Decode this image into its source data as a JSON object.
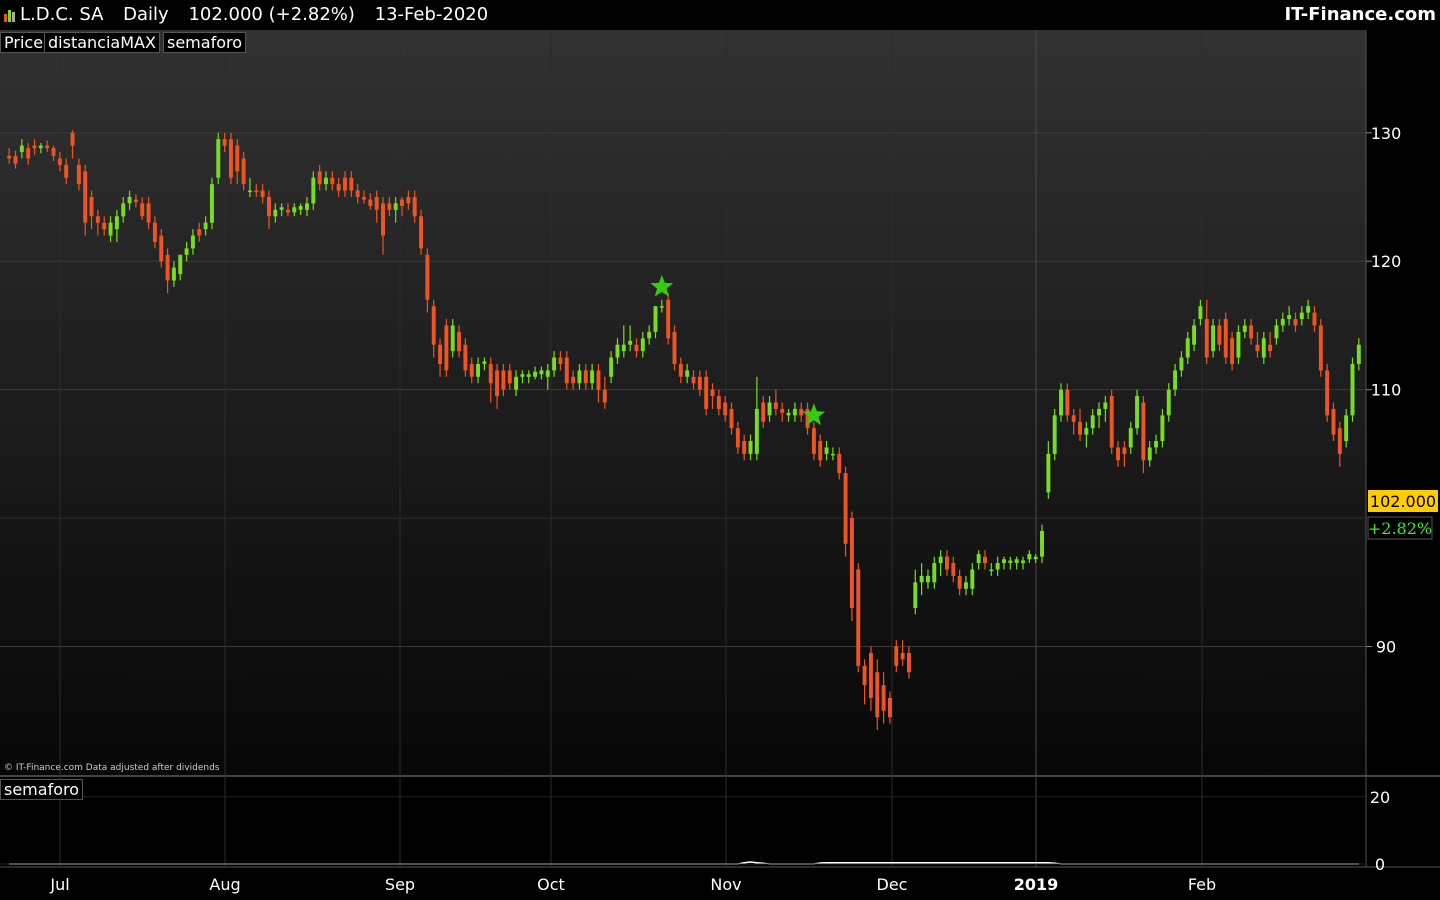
{
  "header": {
    "symbol": "L.D.C. SA",
    "period": "Daily",
    "price_change": "102.000 (+2.82%)",
    "date": "13-Feb-2020",
    "brand": "IT-Finance.com"
  },
  "legend_tags": [
    "Price",
    "distanciaMAX",
    "semaforo"
  ],
  "indicator_tag": "semaforo",
  "footnote": "© IT-Finance.com  Data adjusted after dividends",
  "last_price_label": "102.000",
  "last_change_label": "+2.82%",
  "colors": {
    "up": "#77dd22",
    "down": "#ee5522",
    "star": "#33cc11",
    "price_box": "#ffcc00"
  },
  "chart_data": {
    "type": "candlestick",
    "y_axis": {
      "range": [
        80,
        138
      ],
      "ticks": [
        130,
        120,
        110,
        90
      ]
    },
    "x_axis_labels": [
      "Jul",
      "Aug",
      "Sep",
      "Oct",
      "Nov",
      "Dec",
      "2019",
      "Feb"
    ],
    "candles": [
      [
        128.2,
        128.8,
        127.6,
        128.0
      ],
      [
        128.2,
        128.6,
        127.2,
        127.6
      ],
      [
        128.5,
        129.5,
        128.0,
        129.0
      ],
      [
        128.8,
        129.2,
        127.5,
        128.0
      ],
      [
        129.0,
        129.5,
        128.3,
        128.8
      ],
      [
        128.8,
        129.2,
        128.4,
        129.0
      ],
      [
        129.0,
        129.4,
        128.5,
        128.8
      ],
      [
        128.8,
        129.0,
        127.8,
        128.2
      ],
      [
        128.0,
        128.5,
        127.0,
        127.5
      ],
      [
        127.5,
        128.0,
        126.0,
        126.5
      ],
      [
        130.0,
        130.2,
        128.0,
        129.0
      ],
      [
        127.5,
        128.0,
        125.5,
        126.0
      ],
      [
        127.0,
        127.5,
        122.0,
        123.0
      ],
      [
        125.0,
        125.5,
        122.5,
        123.5
      ],
      [
        123.5,
        124.0,
        122.0,
        123.0
      ],
      [
        123.0,
        123.5,
        122.0,
        122.5
      ],
      [
        122.0,
        123.5,
        121.5,
        123.0
      ],
      [
        122.5,
        124.0,
        121.5,
        123.5
      ],
      [
        123.5,
        125.0,
        123.0,
        124.5
      ],
      [
        124.5,
        125.5,
        124.0,
        125.0
      ],
      [
        124.8,
        125.2,
        124.2,
        124.6
      ],
      [
        124.5,
        125.0,
        123.2,
        123.5
      ],
      [
        124.5,
        125.0,
        122.5,
        123.0
      ],
      [
        123.0,
        123.5,
        121.0,
        121.5
      ],
      [
        122.0,
        122.5,
        119.5,
        120.0
      ],
      [
        120.5,
        121.0,
        117.5,
        118.5
      ],
      [
        118.5,
        120.0,
        118.0,
        119.5
      ],
      [
        119.0,
        120.5,
        118.5,
        120.5
      ],
      [
        120.5,
        121.5,
        120.0,
        121.0
      ],
      [
        121.0,
        122.5,
        120.5,
        122.0
      ],
      [
        122.5,
        123.0,
        121.5,
        122.0
      ],
      [
        122.5,
        123.5,
        122.0,
        123.0
      ],
      [
        123.0,
        126.5,
        122.5,
        126.0
      ],
      [
        126.5,
        130.0,
        126.0,
        129.5
      ],
      [
        129.5,
        130.0,
        128.5,
        129.0
      ],
      [
        129.5,
        130.0,
        126.0,
        126.5
      ],
      [
        129.0,
        129.5,
        126.0,
        127.0
      ],
      [
        128.0,
        128.5,
        125.5,
        126.0
      ],
      [
        125.5,
        126.5,
        125.0,
        125.5
      ],
      [
        125.5,
        126.0,
        125.0,
        125.4
      ],
      [
        125.5,
        126.0,
        124.5,
        125.0
      ],
      [
        125.0,
        125.5,
        122.5,
        123.5
      ],
      [
        123.5,
        124.5,
        123.0,
        124.0
      ],
      [
        124.0,
        124.5,
        123.5,
        124.2
      ],
      [
        124.0,
        124.5,
        123.5,
        123.8
      ],
      [
        123.8,
        124.5,
        123.5,
        124.2
      ],
      [
        124.0,
        124.5,
        123.6,
        124.3
      ],
      [
        124.0,
        125.0,
        123.5,
        124.5
      ],
      [
        124.5,
        127.0,
        124.0,
        126.5
      ],
      [
        127.0,
        127.5,
        125.5,
        126.0
      ],
      [
        126.0,
        127.0,
        125.5,
        126.5
      ],
      [
        126.5,
        127.0,
        125.5,
        126.0
      ],
      [
        126.0,
        126.5,
        125.0,
        125.5
      ],
      [
        126.5,
        127.0,
        125.0,
        125.5
      ],
      [
        126.5,
        127.0,
        125.0,
        125.5
      ],
      [
        125.5,
        126.0,
        124.5,
        125.0
      ],
      [
        125.0,
        125.5,
        124.5,
        124.8
      ],
      [
        124.8,
        125.3,
        124.0,
        124.3
      ],
      [
        125.0,
        125.5,
        123.0,
        124.0
      ],
      [
        124.5,
        125.0,
        120.5,
        122.0
      ],
      [
        124.5,
        125.0,
        123.5,
        124.0
      ],
      [
        124.0,
        125.0,
        123.0,
        124.5
      ],
      [
        124.8,
        125.0,
        123.5,
        124.3
      ],
      [
        125.0,
        125.5,
        124.0,
        124.5
      ],
      [
        125.0,
        125.5,
        123.0,
        123.5
      ],
      [
        123.5,
        124.0,
        120.5,
        121.0
      ],
      [
        120.5,
        121.0,
        116.0,
        117.0
      ],
      [
        116.5,
        117.0,
        112.5,
        113.5
      ],
      [
        113.5,
        114.0,
        111.0,
        112.0
      ],
      [
        115.0,
        115.5,
        111.0,
        111.5
      ],
      [
        113.0,
        115.5,
        112.5,
        115.0
      ],
      [
        114.5,
        115.0,
        112.5,
        113.0
      ],
      [
        113.5,
        114.0,
        111.0,
        111.5
      ],
      [
        112.0,
        112.5,
        110.5,
        111.0
      ],
      [
        111.0,
        112.5,
        110.5,
        112.0
      ],
      [
        112.0,
        112.5,
        111.5,
        112.2
      ],
      [
        112.0,
        112.5,
        109.0,
        110.5
      ],
      [
        111.5,
        112.0,
        108.5,
        109.5
      ],
      [
        111.5,
        112.0,
        109.5,
        110.0
      ],
      [
        111.5,
        112.0,
        110.0,
        110.5
      ],
      [
        110.0,
        111.5,
        109.5,
        111.0
      ],
      [
        111.0,
        111.5,
        110.5,
        111.2
      ],
      [
        111.0,
        111.5,
        110.5,
        111.2
      ],
      [
        111.0,
        111.8,
        110.8,
        111.4
      ],
      [
        111.2,
        111.8,
        110.8,
        111.5
      ],
      [
        111.0,
        112.0,
        110.0,
        111.5
      ],
      [
        111.5,
        113.0,
        111.0,
        112.5
      ],
      [
        112.5,
        113.0,
        111.5,
        112.0
      ],
      [
        112.5,
        113.0,
        110.0,
        110.5
      ],
      [
        111.0,
        111.5,
        110.0,
        110.5
      ],
      [
        110.5,
        112.0,
        110.0,
        111.5
      ],
      [
        111.5,
        112.0,
        110.0,
        110.5
      ],
      [
        110.5,
        112.0,
        110.0,
        111.5
      ],
      [
        111.5,
        112.0,
        109.0,
        110.0
      ],
      [
        110.0,
        111.0,
        108.5,
        109.0
      ],
      [
        111.0,
        113.0,
        110.5,
        112.5
      ],
      [
        112.5,
        114.0,
        112.0,
        113.5
      ],
      [
        113.0,
        115.0,
        112.5,
        113.5
      ],
      [
        113.5,
        115.0,
        113.0,
        113.8
      ],
      [
        113.5,
        114.0,
        112.5,
        113.0
      ],
      [
        113.0,
        114.5,
        112.5,
        114.0
      ],
      [
        114.0,
        115.0,
        113.5,
        114.5
      ],
      [
        114.5,
        116.5,
        114.0,
        116.5
      ],
      [
        116.5,
        117.0,
        116.0,
        116.5
      ],
      [
        117.0,
        117.5,
        113.5,
        114.0
      ],
      [
        114.5,
        115.0,
        111.5,
        112.0
      ],
      [
        112.0,
        112.5,
        110.5,
        111.0
      ],
      [
        111.0,
        112.0,
        110.5,
        111.5
      ],
      [
        111.0,
        111.5,
        110.0,
        110.5
      ],
      [
        111.0,
        111.5,
        109.5,
        110.0
      ],
      [
        111.0,
        111.5,
        108.0,
        108.5
      ],
      [
        110.0,
        110.5,
        108.5,
        109.5
      ],
      [
        109.5,
        110.0,
        108.0,
        108.5
      ],
      [
        109.0,
        109.5,
        107.5,
        108.0
      ],
      [
        108.5,
        109.0,
        106.5,
        107.0
      ],
      [
        107.0,
        107.5,
        105.0,
        105.5
      ],
      [
        106.0,
        106.5,
        104.5,
        105.0
      ],
      [
        105.0,
        106.5,
        104.5,
        106.0
      ],
      [
        105.0,
        111.0,
        104.5,
        108.5
      ],
      [
        109.0,
        109.5,
        107.0,
        107.5
      ],
      [
        108.0,
        109.5,
        107.5,
        109.0
      ],
      [
        109.0,
        110.0,
        108.0,
        108.5
      ],
      [
        108.5,
        109.0,
        107.5,
        108.2
      ],
      [
        108.0,
        108.5,
        107.5,
        108.2
      ],
      [
        108.0,
        109.0,
        107.5,
        108.5
      ],
      [
        108.5,
        109.0,
        107.5,
        108.0
      ],
      [
        108.5,
        109.0,
        106.5,
        107.0
      ],
      [
        107.0,
        107.5,
        104.5,
        105.0
      ],
      [
        106.0,
        106.5,
        104.0,
        104.5
      ],
      [
        105.0,
        106.0,
        104.5,
        105.5
      ],
      [
        105.0,
        105.5,
        104.5,
        105.0
      ],
      [
        105.0,
        105.5,
        103.0,
        103.5
      ],
      [
        103.5,
        104.0,
        97.0,
        98.0
      ],
      [
        100.0,
        100.5,
        92.0,
        93.0
      ],
      [
        96.0,
        96.5,
        88.0,
        88.5
      ],
      [
        88.5,
        89.0,
        85.5,
        87.0
      ],
      [
        89.5,
        90.0,
        85.0,
        86.0
      ],
      [
        88.0,
        89.0,
        83.5,
        84.5
      ],
      [
        87.0,
        88.0,
        84.0,
        85.0
      ],
      [
        86.0,
        86.5,
        84.0,
        84.5
      ],
      [
        90.0,
        90.5,
        88.0,
        88.5
      ],
      [
        89.5,
        90.5,
        88.5,
        89.0
      ],
      [
        89.5,
        90.0,
        87.5,
        88.0
      ],
      [
        93.0,
        96.0,
        92.5,
        95.0
      ],
      [
        95.0,
        96.5,
        94.0,
        95.5
      ],
      [
        95.0,
        96.0,
        94.5,
        95.5
      ],
      [
        95.0,
        97.0,
        94.5,
        96.5
      ],
      [
        96.5,
        97.5,
        95.5,
        97.0
      ],
      [
        97.0,
        97.5,
        95.5,
        96.0
      ],
      [
        96.5,
        97.0,
        95.0,
        95.5
      ],
      [
        95.5,
        96.0,
        94.0,
        94.5
      ],
      [
        94.5,
        95.5,
        94.0,
        95.0
      ],
      [
        94.5,
        96.5,
        94.0,
        96.0
      ],
      [
        96.5,
        97.5,
        96.0,
        97.2
      ],
      [
        97.0,
        97.5,
        96.0,
        96.5
      ],
      [
        96.0,
        96.5,
        95.5,
        96.0
      ],
      [
        96.0,
        97.0,
        95.5,
        96.5
      ],
      [
        96.5,
        97.0,
        96.0,
        96.8
      ],
      [
        96.5,
        97.0,
        96.0,
        96.7
      ],
      [
        96.5,
        97.0,
        96.0,
        96.8
      ],
      [
        96.5,
        97.0,
        96.0,
        96.7
      ],
      [
        96.8,
        97.5,
        96.5,
        97.2
      ],
      [
        96.8,
        97.2,
        96.5,
        97.0
      ],
      [
        97.0,
        99.5,
        96.5,
        99.0
      ],
      [
        102.0,
        106.0,
        101.5,
        105.0
      ],
      [
        105.0,
        108.5,
        104.5,
        108.0
      ],
      [
        108.0,
        110.5,
        107.5,
        110.0
      ],
      [
        110.0,
        110.5,
        107.5,
        108.0
      ],
      [
        108.0,
        108.5,
        106.5,
        107.5
      ],
      [
        107.5,
        108.5,
        106.0,
        106.5
      ],
      [
        106.5,
        107.5,
        105.5,
        107.0
      ],
      [
        107.0,
        108.5,
        106.5,
        108.0
      ],
      [
        108.0,
        109.0,
        107.0,
        108.5
      ],
      [
        108.5,
        109.5,
        107.5,
        109.0
      ],
      [
        109.5,
        110.0,
        105.0,
        105.5
      ],
      [
        105.5,
        106.0,
        104.0,
        104.5
      ],
      [
        105.5,
        106.0,
        104.0,
        105.0
      ],
      [
        105.5,
        107.5,
        105.0,
        107.0
      ],
      [
        107.0,
        110.0,
        106.5,
        109.5
      ],
      [
        109.0,
        109.5,
        103.5,
        104.5
      ],
      [
        104.5,
        106.0,
        104.0,
        105.5
      ],
      [
        105.5,
        106.5,
        105.0,
        106.0
      ],
      [
        106.0,
        108.5,
        105.5,
        108.0
      ],
      [
        108.0,
        110.5,
        107.5,
        110.0
      ],
      [
        110.0,
        112.0,
        109.5,
        111.5
      ],
      [
        111.5,
        113.0,
        111.0,
        112.5
      ],
      [
        112.5,
        114.5,
        112.0,
        114.0
      ],
      [
        113.5,
        115.5,
        113.0,
        115.0
      ],
      [
        115.5,
        117.0,
        115.0,
        116.5
      ],
      [
        115.5,
        117.0,
        112.0,
        112.5
      ],
      [
        113.0,
        115.5,
        112.5,
        115.0
      ],
      [
        115.0,
        115.5,
        113.0,
        113.5
      ],
      [
        115.5,
        116.0,
        112.0,
        112.5
      ],
      [
        114.0,
        114.5,
        111.5,
        112.0
      ],
      [
        112.5,
        115.0,
        112.0,
        114.5
      ],
      [
        114.5,
        115.5,
        114.0,
        115.0
      ],
      [
        115.0,
        115.5,
        113.5,
        114.0
      ],
      [
        113.5,
        114.5,
        112.5,
        113.0
      ],
      [
        112.5,
        114.5,
        112.0,
        114.0
      ],
      [
        113.5,
        114.5,
        112.5,
        113.0
      ],
      [
        114.0,
        115.5,
        113.5,
        115.0
      ],
      [
        115.0,
        116.0,
        114.5,
        115.5
      ],
      [
        115.5,
        116.5,
        115.0,
        115.8
      ],
      [
        115.5,
        116.0,
        114.5,
        115.0
      ],
      [
        115.5,
        116.5,
        115.0,
        116.0
      ],
      [
        116.0,
        117.0,
        115.5,
        116.5
      ],
      [
        116.0,
        116.5,
        114.5,
        115.0
      ],
      [
        115.0,
        115.5,
        111.0,
        111.5
      ],
      [
        111.5,
        112.0,
        107.5,
        108.0
      ],
      [
        108.5,
        109.0,
        106.0,
        106.5
      ],
      [
        107.0,
        107.5,
        104.0,
        105.0
      ],
      [
        106.0,
        108.5,
        105.5,
        108.0
      ],
      [
        108.0,
        112.5,
        107.5,
        112.0
      ],
      [
        112.0,
        114.0,
        111.5,
        113.5
      ]
    ],
    "signals": [
      {
        "index": 103,
        "price": 118.0
      },
      {
        "index": 127,
        "price": 108.0
      }
    ],
    "indicator": {
      "name": "semaforo",
      "y_range": [
        0,
        25
      ],
      "ticks": [
        20,
        0
      ],
      "values": [
        0,
        0,
        0,
        0,
        0,
        0,
        0,
        0,
        0,
        0,
        0,
        0,
        0,
        0,
        0,
        0,
        0,
        0,
        0,
        0,
        0,
        0,
        0,
        0,
        0,
        0,
        0,
        0,
        0,
        0,
        0,
        0,
        0,
        0,
        0,
        0,
        0,
        0,
        0,
        0,
        0,
        0,
        0,
        0,
        0,
        0,
        0,
        0,
        0,
        0,
        0,
        0,
        0,
        0,
        0,
        0,
        0,
        0,
        0,
        0,
        0,
        0,
        0,
        0,
        0,
        0,
        0,
        0,
        0,
        0,
        0,
        0,
        0,
        0,
        0,
        0,
        0,
        0,
        0,
        0,
        0,
        0,
        0,
        0,
        0,
        0,
        0,
        0,
        0,
        0,
        0,
        0,
        0,
        0,
        0,
        0,
        0,
        0,
        0,
        0,
        0,
        0,
        0,
        0,
        0,
        0,
        0,
        0,
        0,
        0,
        0,
        0,
        0,
        0,
        0,
        0,
        0.4,
        0.6,
        0.4,
        0.2,
        0,
        0,
        0,
        0,
        0,
        0,
        0,
        0,
        0.3,
        0.4,
        0.4,
        0.4,
        0.4,
        0.4,
        0.4,
        0.4,
        0.4,
        0.4,
        0.4,
        0.4,
        0.4,
        0.4,
        0.4,
        0.4,
        0.4,
        0.4,
        0.4,
        0.4,
        0.4,
        0.4,
        0.4,
        0.4,
        0.4,
        0.4,
        0.4,
        0.4,
        0.4,
        0.4,
        0.4,
        0.4,
        0.4,
        0.4,
        0.4,
        0.4,
        0.4,
        0.2,
        0,
        0,
        0,
        0,
        0,
        0,
        0,
        0,
        0,
        0,
        0,
        0,
        0,
        0,
        0,
        0,
        0,
        0,
        0,
        0,
        0,
        0,
        0,
        0,
        0,
        0,
        0,
        0,
        0,
        0,
        0,
        0,
        0,
        0,
        0,
        0,
        0,
        0,
        0,
        0,
        0,
        0,
        0,
        0,
        0,
        0,
        0,
        0
      ]
    }
  }
}
